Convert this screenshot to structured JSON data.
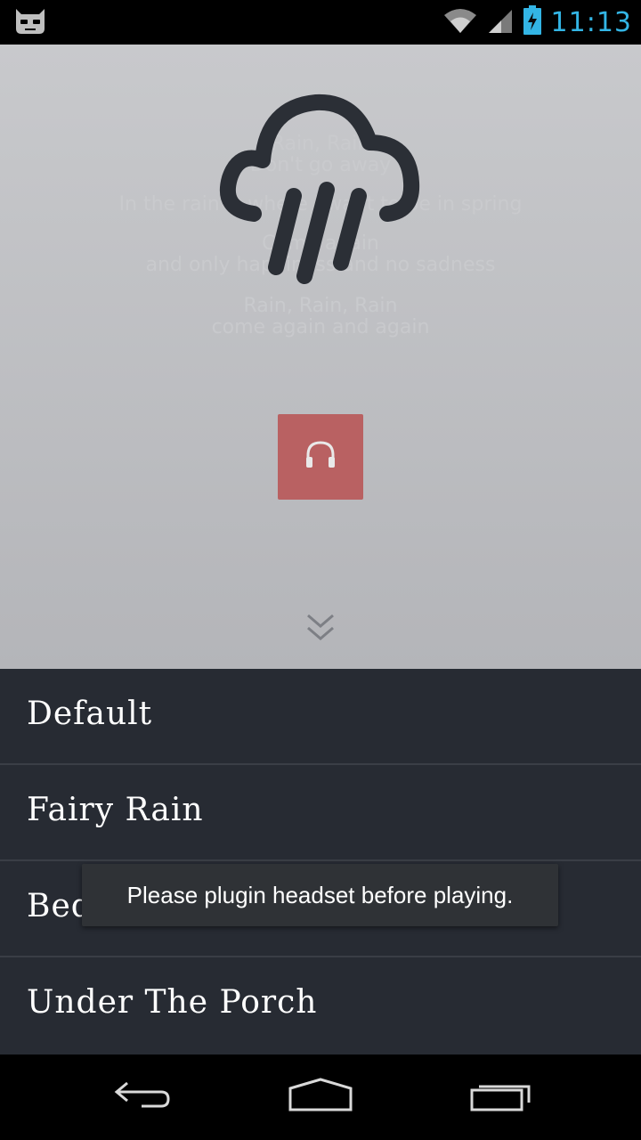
{
  "status_bar": {
    "time": "11:13",
    "icons": [
      "cyanogen-mascot-icon",
      "wifi-icon",
      "signal-icon",
      "battery-charging-icon"
    ]
  },
  "hero": {
    "lyrics": [
      "Rain, Rain",
      "Don't go away",
      "In the rain is where I want to be in spring",
      "Come again",
      "and only happiness and no sadness",
      "Rain, Rain, Rain",
      "come again and again"
    ],
    "icons": [
      "cloud-rain-icon",
      "headset-icon",
      "double-chevron-down-icon"
    ]
  },
  "sound_list": {
    "items": [
      {
        "label": "Default"
      },
      {
        "label": "Fairy Rain"
      },
      {
        "label": "Bedroom"
      },
      {
        "label": "Under The Porch"
      }
    ]
  },
  "toast": {
    "message": "Please plugin headset before playing."
  },
  "nav_bar": {
    "icons": [
      "back-icon",
      "home-icon",
      "recents-icon"
    ]
  },
  "colors": {
    "accent_time": "#33b5e5",
    "list_background": "#272b33",
    "headset_button": "#b96162",
    "icon_dark": "#2b2f36"
  }
}
